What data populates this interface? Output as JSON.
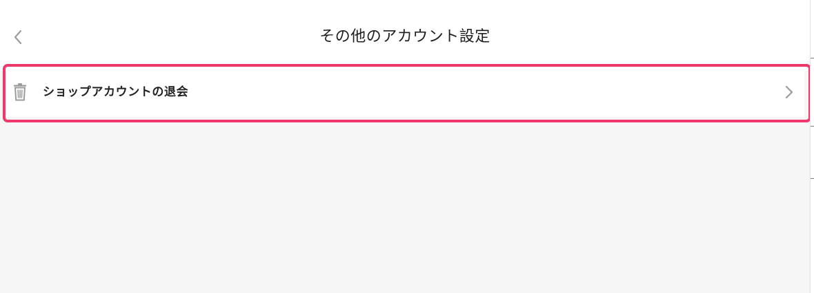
{
  "header": {
    "title": "その他のアカウント設定",
    "back_icon": "chevron-left-icon"
  },
  "settings_list": {
    "items": [
      {
        "label": "ショップアカウントの退会",
        "icon": "trash-icon",
        "trailing_icon": "chevron-right-icon"
      }
    ]
  },
  "colors": {
    "highlight": "#f0386b",
    "icon_gray": "#9b9b9b",
    "background": "#f7f6f7",
    "text": "#1e1e1e"
  }
}
